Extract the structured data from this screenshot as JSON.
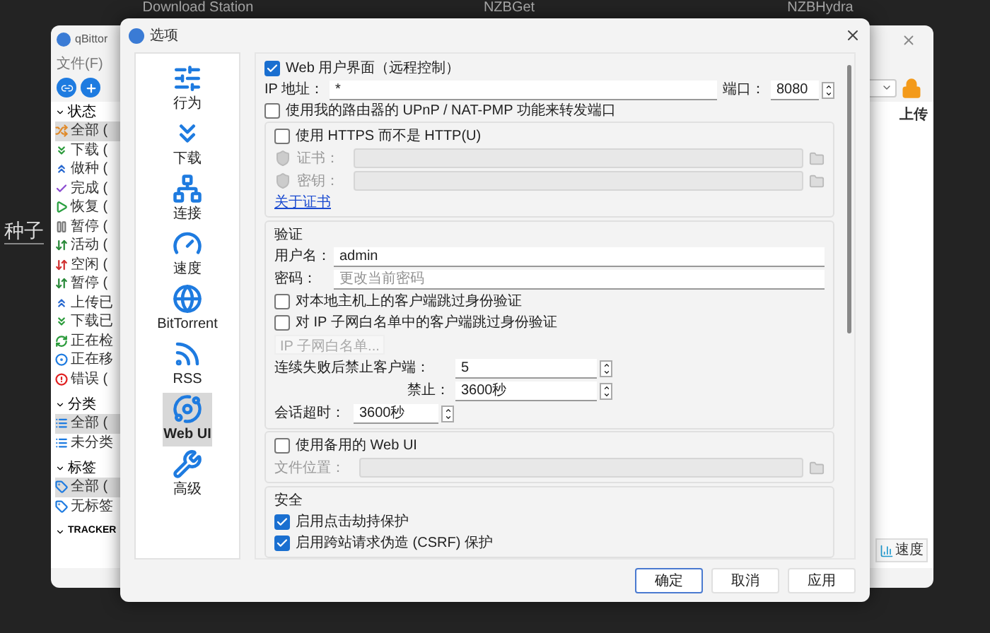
{
  "desktop": {
    "tile_titles": [
      "Download Station",
      "NZBGet",
      "NZBHydra"
    ],
    "section_label": "种子"
  },
  "main_window": {
    "title": "qBittor",
    "menu": [
      "文件(F)"
    ],
    "sidebar": [
      {
        "header": "状态",
        "expanded": true,
        "items": [
          {
            "label": "全部 (",
            "selected": true
          },
          {
            "label": "下载 (",
            "selected": false
          },
          {
            "label": "做种 (",
            "selected": false
          },
          {
            "label": "完成 (",
            "selected": false
          },
          {
            "label": "恢复 (",
            "selected": false
          },
          {
            "label": "暂停 (",
            "selected": false
          },
          {
            "label": "活动 (",
            "selected": false
          },
          {
            "label": "空闲 (",
            "selected": false
          },
          {
            "label": "暂停 (",
            "selected": false
          },
          {
            "label": "上传已",
            "selected": false
          },
          {
            "label": "下载已",
            "selected": false
          },
          {
            "label": "正在检",
            "selected": false
          },
          {
            "label": "正在移",
            "selected": false
          },
          {
            "label": "错误 (",
            "selected": false
          }
        ]
      },
      {
        "header": "分类",
        "expanded": true,
        "items": [
          {
            "label": "全部 (",
            "selected": true
          },
          {
            "label": "未分类",
            "selected": false
          }
        ]
      },
      {
        "header": "标签",
        "expanded": true,
        "items": [
          {
            "label": "全部 (",
            "selected": true
          },
          {
            "label": "无标签",
            "selected": false
          }
        ]
      },
      {
        "header": "TRACKER",
        "expanded": true
      }
    ],
    "column_header": "上传",
    "speed_button": "速度"
  },
  "dialog": {
    "title": "选项",
    "nav": [
      {
        "label": "行为",
        "selected": false
      },
      {
        "label": "下载",
        "selected": false
      },
      {
        "label": "连接",
        "selected": false
      },
      {
        "label": "速度",
        "selected": false
      },
      {
        "label": "BitTorrent",
        "selected": false
      },
      {
        "label": "RSS",
        "selected": false
      },
      {
        "label": "Web UI",
        "selected": true
      },
      {
        "label": "高级",
        "selected": false
      }
    ],
    "web_ui": {
      "enabled": {
        "label": "Web 用户界面（远程控制）",
        "checked": true
      },
      "ip": {
        "label": "IP 地址：",
        "value": "*"
      },
      "port": {
        "label": "端口：",
        "value": "8080"
      },
      "upnp": {
        "label": "使用我的路由器的 UPnP / NAT-PMP 功能来转发端口",
        "checked": false
      },
      "https": {
        "label": "使用 HTTPS 而不是 HTTP(U)",
        "checked": false,
        "cert": {
          "label": "证书："
        },
        "key": {
          "label": "密钥："
        },
        "link": "关于证书"
      },
      "auth": {
        "title": "验证",
        "username": {
          "label": "用户名：",
          "value": "admin"
        },
        "password": {
          "label": "密码：",
          "placeholder": "更改当前密码"
        },
        "options": [
          {
            "label": "对本地主机上的客户端跳过身份验证",
            "checked": false
          },
          {
            "label": "对 IP 子网白名单中的客户端跳过身份验证",
            "checked": false
          }
        ],
        "whitelist_button": "IP 子网白名单...",
        "ban_after": {
          "label": "连续失败后禁止客户端：",
          "value": "5"
        },
        "ban_time": {
          "label": "禁止：",
          "value": "3600秒"
        },
        "session_timeout": {
          "label": "会话超时：",
          "value": "3600秒"
        }
      },
      "alt_ui": {
        "label": "使用备用的 Web UI",
        "checked": false,
        "location": {
          "label": "文件位置："
        }
      },
      "security": {
        "title": "安全",
        "options": [
          {
            "label": "启用点击劫持保护",
            "checked": true
          },
          {
            "label": "启用跨站请求伪造 (CSRF) 保护",
            "checked": true
          }
        ]
      }
    },
    "buttons": [
      {
        "label": "确定",
        "default": true
      },
      {
        "label": "取消",
        "default": false
      },
      {
        "label": "应用",
        "default": false
      }
    ]
  }
}
